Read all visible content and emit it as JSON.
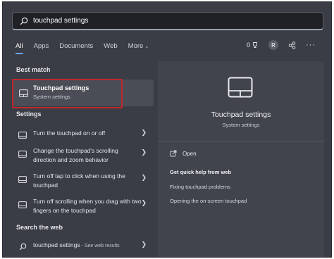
{
  "search": {
    "value": "touchpad settings"
  },
  "tabs": [
    {
      "label": "All",
      "active": true
    },
    {
      "label": "Apps"
    },
    {
      "label": "Documents"
    },
    {
      "label": "Web"
    },
    {
      "label": "More"
    }
  ],
  "toolbar": {
    "points": "0",
    "avatar_letter": "R"
  },
  "best_match": {
    "section": "Best match",
    "title": "Touchpad settings",
    "subtitle": "System settings"
  },
  "settings": {
    "section": "Settings",
    "items": [
      {
        "label": "Turn the touchpad on or off"
      },
      {
        "label": "Change the touchpad's scrolling direction and zoom behavior"
      },
      {
        "label": "Turn off tap to click when using the touchpad"
      },
      {
        "label": "Turn off scrolling when you drag with two fingers on the touchpad"
      }
    ]
  },
  "web": {
    "section": "Search the web",
    "query": "touchpad settings",
    "suffix": " - See web results"
  },
  "details": {
    "title": "Touchpad settings",
    "subtitle": "System settings",
    "open": "Open",
    "help_heading": "Get quick help from web",
    "links": [
      "Fixing touchpad problems",
      "Opening the on-screen touchpad"
    ]
  },
  "colors": {
    "highlight": "#c0282d",
    "accent": "#6aa4e8",
    "panel": "#3a3d45"
  }
}
